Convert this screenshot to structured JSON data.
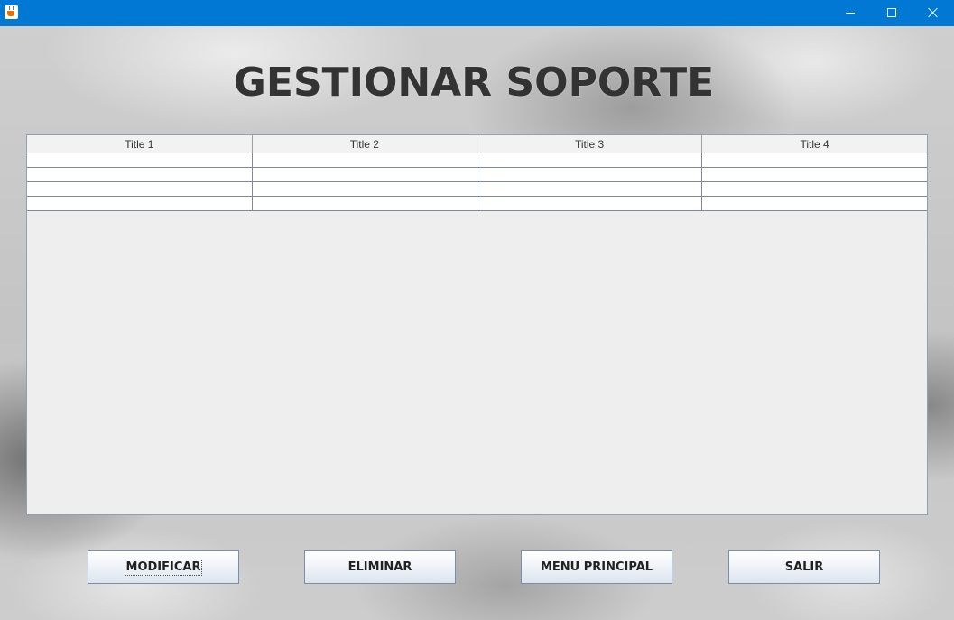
{
  "window": {
    "title_bar_color": "#0078d4",
    "app_icon": "java-cup-icon",
    "controls": [
      "minimize-icon",
      "maximize-icon",
      "close-icon"
    ]
  },
  "main": {
    "title": "GESTIONAR SOPORTE"
  },
  "table": {
    "columns": [
      "Title 1",
      "Title 2",
      "Title 3",
      "Title 4"
    ],
    "rows": [
      [
        "",
        "",
        "",
        ""
      ],
      [
        "",
        "",
        "",
        ""
      ],
      [
        "",
        "",
        "",
        ""
      ],
      [
        "",
        "",
        "",
        ""
      ]
    ]
  },
  "buttons": {
    "modify": "MODIFICAR",
    "delete": "ELIMINAR",
    "main_menu": "MENU PRINCIPAL",
    "exit": "SALIR"
  }
}
